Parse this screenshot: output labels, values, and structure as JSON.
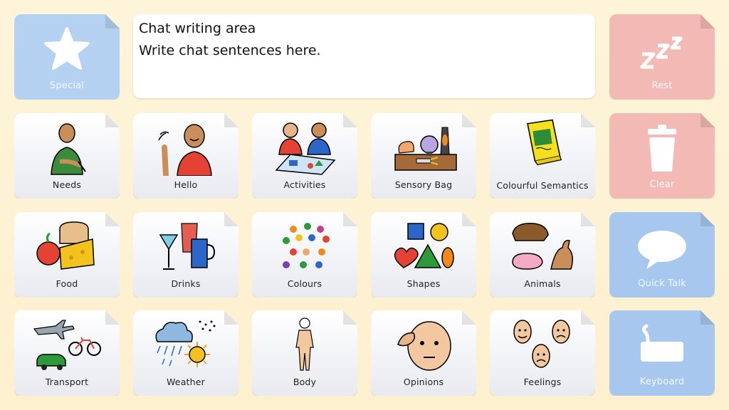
{
  "chat": {
    "title": "Chat writing area",
    "placeholder": "Write chat sentences here."
  },
  "side_buttons": {
    "special": "Special",
    "rest": "Rest",
    "clear": "Clear",
    "quick_talk": "Quick Talk",
    "keyboard": "Keyboard"
  },
  "categories": {
    "needs": "Needs",
    "hello": "Hello",
    "activities": "Activities",
    "sensory_bag": "Sensory Bag",
    "colourful_semantics": "Colourful Semantics",
    "food": "Food",
    "drinks": "Drinks",
    "colours": "Colours",
    "shapes": "Shapes",
    "animals": "Animals",
    "transport": "Transport",
    "weather": "Weather",
    "body": "Body",
    "opinions": "Opinions",
    "feelings": "Feelings"
  },
  "colors": {
    "blue_tile": "#b5d1f2",
    "pink_tile": "#f3b9b5",
    "background": "#fdf4da"
  }
}
